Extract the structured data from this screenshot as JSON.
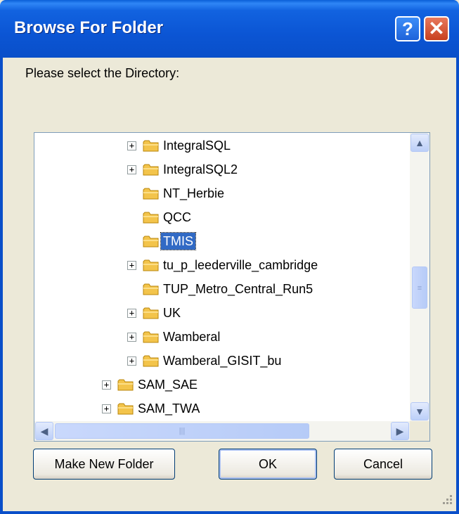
{
  "window": {
    "title": "Browse For Folder",
    "help_glyph": "?",
    "close_glyph": "✕"
  },
  "prompt": "Please select the Directory:",
  "tree": {
    "items": [
      {
        "label": "IntegralSQL",
        "expander": "+",
        "level": 2,
        "selected": false
      },
      {
        "label": "IntegralSQL2",
        "expander": "+",
        "level": 2,
        "selected": false
      },
      {
        "label": "NT_Herbie",
        "expander": "",
        "level": 2,
        "selected": false
      },
      {
        "label": "QCC",
        "expander": "",
        "level": 2,
        "selected": false
      },
      {
        "label": "TMIS",
        "expander": "",
        "level": 2,
        "selected": true
      },
      {
        "label": "tu_p_leederville_cambridge",
        "expander": "+",
        "level": 2,
        "selected": false
      },
      {
        "label": "TUP_Metro_Central_Run5",
        "expander": "",
        "level": 2,
        "selected": false
      },
      {
        "label": "UK",
        "expander": "+",
        "level": 2,
        "selected": false
      },
      {
        "label": "Wamberal",
        "expander": "+",
        "level": 2,
        "selected": false
      },
      {
        "label": "Wamberal_GISIT_bu",
        "expander": "+",
        "level": 2,
        "selected": false
      },
      {
        "label": "SAM_SAE",
        "expander": "+",
        "level": 1,
        "selected": false
      },
      {
        "label": "SAM_TWA",
        "expander": "+",
        "level": 1,
        "selected": false
      }
    ],
    "vscroll_position_fraction": 0.55,
    "hscroll_position_fraction": 0.0
  },
  "buttons": {
    "make_new_folder": "Make New Folder",
    "ok": "OK",
    "cancel": "Cancel"
  },
  "colors": {
    "titlebar": "#0a55d4",
    "selection": "#316ac5",
    "dialog_bg": "#ece9d8",
    "folder": "#f3c44b"
  }
}
